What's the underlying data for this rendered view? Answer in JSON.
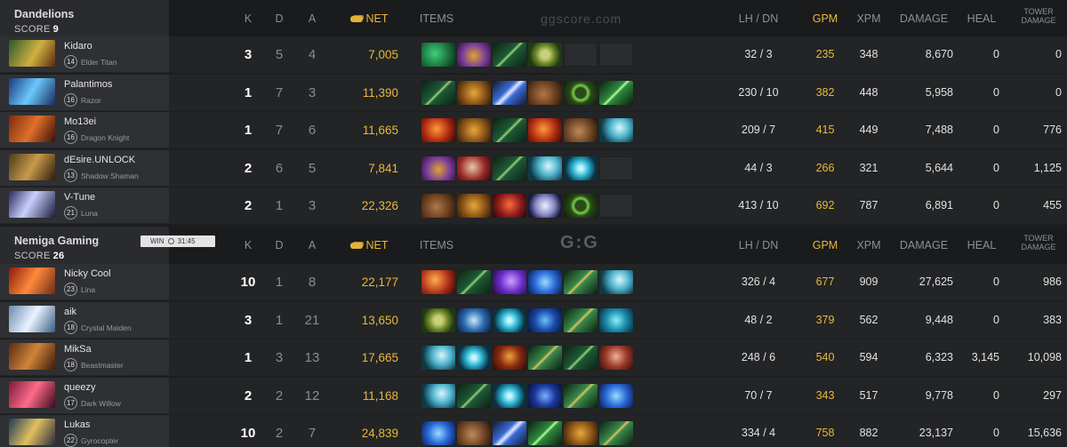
{
  "columns": {
    "k": "K",
    "d": "D",
    "a": "A",
    "net": "NET",
    "items": "ITEMS",
    "lhdn": "LH  /  DN",
    "gpm": "GPM",
    "xpm": "XPM",
    "damage": "DAMAGE",
    "heal": "HEAL",
    "tower_line1": "TOWER",
    "tower_line2": "DAMAGE"
  },
  "watermark": {
    "site": "ggscore.com",
    "logo": "G:G"
  },
  "colors": {
    "gold": "#e9b83a",
    "header_gold_icon": "#e2b23a",
    "win_badge": "#e3e3e3"
  },
  "teams": [
    {
      "name": "Dandelions",
      "score_label": "SCORE",
      "score": "9",
      "players": [
        {
          "name": "Kidaro",
          "level": "14",
          "hero": "Elder Titan",
          "k": "3",
          "d": "5",
          "a": "4",
          "net": "7,005",
          "lhdn": "32  /  3",
          "gpm": "235",
          "xpm": "348",
          "damage": "8,670",
          "heal": "0",
          "tower": "0",
          "items": [
            "boots-of-travel",
            "hand-of-midas",
            "wand",
            "tranquil",
            "empty",
            "empty"
          ]
        },
        {
          "name": "Palantimos",
          "level": "16",
          "hero": "Razor",
          "k": "1",
          "d": "7",
          "a": "3",
          "net": "11,390",
          "lhdn": "230  /  10",
          "gpm": "382",
          "xpm": "448",
          "damage": "5,958",
          "heal": "0",
          "tower": "0",
          "items": [
            "wand",
            "phase-boots",
            "yasha",
            "power-treads",
            "ring",
            "dagger"
          ]
        },
        {
          "name": "Mo13ei",
          "level": "16",
          "hero": "Dragon Knight",
          "k": "1",
          "d": "7",
          "a": "6",
          "net": "11,665",
          "lhdn": "209  /  7",
          "gpm": "415",
          "xpm": "449",
          "damage": "7,488",
          "heal": "0",
          "tower": "776",
          "items": [
            "armlet",
            "phase-boots",
            "wand",
            "armlet",
            "boots",
            "blink"
          ]
        },
        {
          "name": "dEsire.UNLOCK",
          "level": "13",
          "hero": "Shadow Shaman",
          "k": "2",
          "d": "6",
          "a": "5",
          "net": "7,841",
          "lhdn": "44  /  3",
          "gpm": "266",
          "xpm": "321",
          "damage": "5,644",
          "heal": "0",
          "tower": "1,125",
          "items": [
            "hand-of-midas",
            "axe",
            "wand",
            "blink",
            "orb",
            "empty"
          ]
        },
        {
          "name": "V-Tune",
          "level": "21",
          "hero": "Luna",
          "k": "2",
          "d": "1",
          "a": "3",
          "net": "22,326",
          "lhdn": "413  /  10",
          "gpm": "692",
          "xpm": "787",
          "damage": "6,891",
          "heal": "0",
          "tower": "455",
          "items": [
            "power-treads",
            "phase-boots",
            "helm",
            "skull",
            "ring",
            "empty"
          ]
        }
      ]
    },
    {
      "name": "Nemiga Gaming",
      "score_label": "SCORE",
      "score": "26",
      "result": "WIN",
      "duration": "31:45",
      "players": [
        {
          "name": "Nicky Cool",
          "level": "23",
          "hero": "Lina",
          "k": "10",
          "d": "1",
          "a": "8",
          "net": "22,177",
          "lhdn": "326  /  4",
          "gpm": "677",
          "xpm": "909",
          "damage": "27,625",
          "heal": "0",
          "tower": "986",
          "items": [
            "cloak",
            "wand",
            "dagon",
            "scepter",
            "staff",
            "blink"
          ]
        },
        {
          "name": "aik",
          "level": "18",
          "hero": "Crystal Maiden",
          "k": "3",
          "d": "1",
          "a": "21",
          "net": "13,650",
          "lhdn": "48  /  2",
          "gpm": "379",
          "xpm": "562",
          "damage": "9,448",
          "heal": "0",
          "tower": "383",
          "items": [
            "tranquil",
            "potion",
            "orb",
            "greaves",
            "staff",
            "ward"
          ]
        },
        {
          "name": "MikSa",
          "level": "18",
          "hero": "Beastmaster",
          "k": "1",
          "d": "3",
          "a": "13",
          "net": "17,665",
          "lhdn": "248  /  6",
          "gpm": "540",
          "xpm": "594",
          "damage": "6,323",
          "heal": "3,145",
          "tower": "10,098",
          "items": [
            "blink",
            "orb",
            "crimson",
            "staff",
            "wand",
            "mask"
          ]
        },
        {
          "name": "queezy",
          "level": "17",
          "hero": "Dark Willow",
          "k": "2",
          "d": "2",
          "a": "12",
          "net": "11,168",
          "lhdn": "70  /  7",
          "gpm": "343",
          "xpm": "517",
          "damage": "9,778",
          "heal": "0",
          "tower": "297",
          "items": [
            "blink",
            "wand",
            "orb",
            "lens",
            "staff",
            "scepter"
          ]
        },
        {
          "name": "Lukas",
          "level": "22",
          "hero": "Gyrocopter",
          "k": "10",
          "d": "2",
          "a": "7",
          "net": "24,839",
          "lhdn": "334  /  4",
          "gpm": "758",
          "xpm": "882",
          "damage": "23,137",
          "heal": "0",
          "tower": "15,636",
          "items": [
            "scepter",
            "boots",
            "yasha",
            "dagger",
            "phase-boots",
            "staff"
          ]
        }
      ]
    }
  ]
}
